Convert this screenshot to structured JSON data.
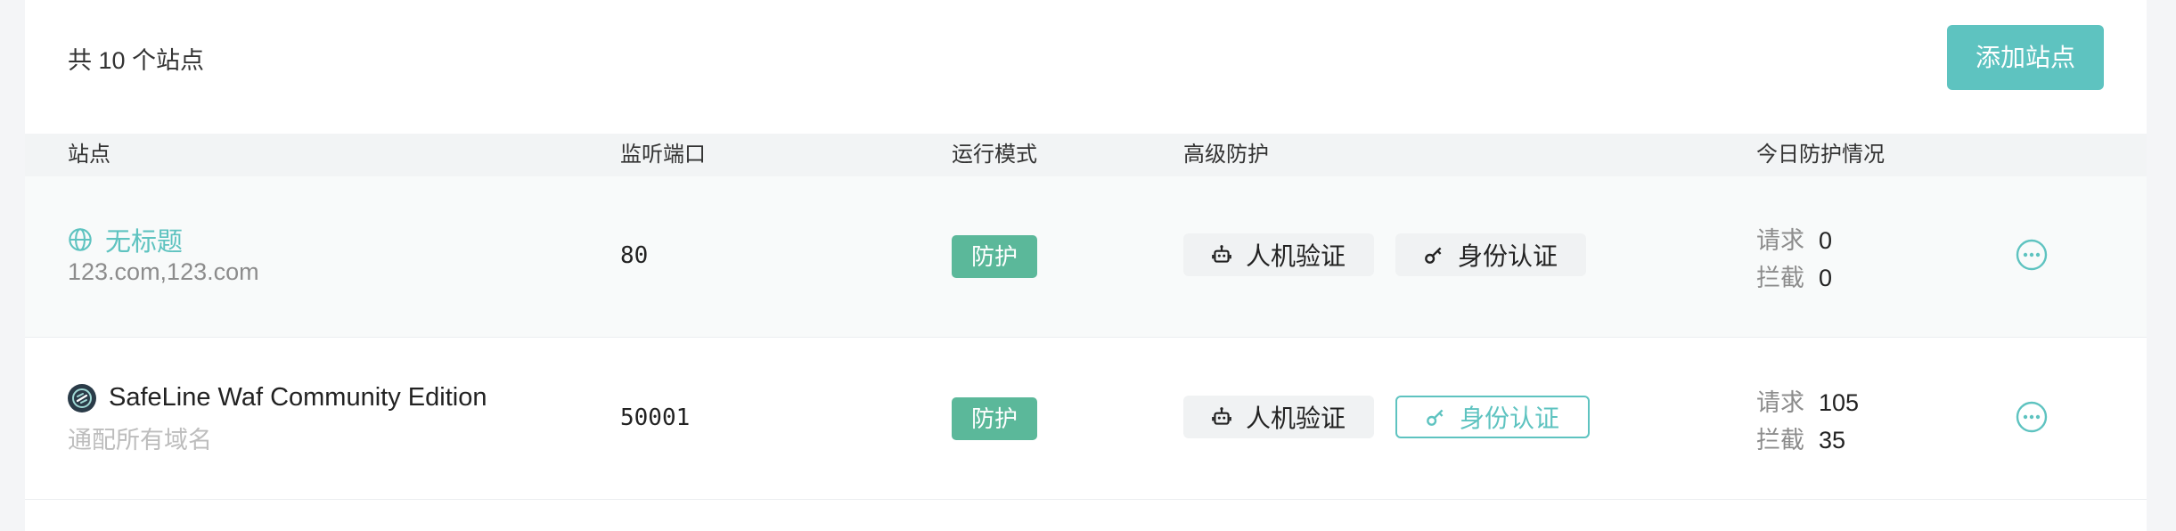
{
  "header": {
    "total_text": "共 10 个站点",
    "add_button_label": "添加站点"
  },
  "table": {
    "columns": [
      "站点",
      "监听端口",
      "运行模式",
      "高级防护",
      "今日防护情况"
    ],
    "rows": [
      {
        "name": "无标题",
        "domain": "123.com,123.com",
        "icon": "globe-icon",
        "port": "80",
        "mode": "防护",
        "protections": [
          "人机验证",
          "身份认证"
        ],
        "stat_labels": [
          "请求",
          "拦截"
        ],
        "requests": "0",
        "blocked": "0"
      },
      {
        "name": "SafeLine Waf Community Edition",
        "domain": "通配所有域名",
        "icon": "safeline-logo-icon",
        "port": "50001",
        "mode": "防护",
        "protections": [
          "人机验证",
          "身份认证"
        ],
        "stat_labels": [
          "请求",
          "拦截"
        ],
        "requests": "105",
        "blocked": "35"
      }
    ]
  },
  "colors": {
    "accent": "#5ec3c0",
    "mode_badge": "#5bb89a"
  }
}
